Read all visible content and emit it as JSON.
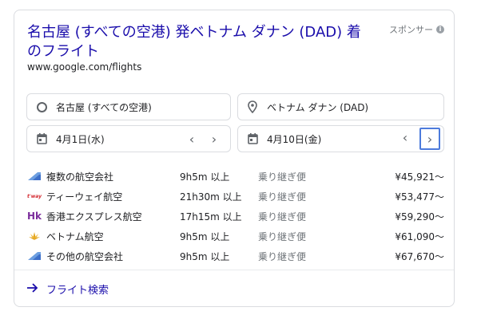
{
  "ad": {
    "title": "名古屋 (すべての空港) 発ベトナム ダナン (DAD) 着のフライト",
    "sponsor_label": "スポンサー",
    "url": "www.google.com/flights"
  },
  "search": {
    "origin": "名古屋 (すべての空港)",
    "destination": "ベトナム ダナン (DAD)",
    "depart_date": "4月1日(水)",
    "return_date": "4月10日(金)"
  },
  "results": [
    {
      "airline": "複数の航空会社",
      "logo": "multi-airline-logo",
      "duration": "9h5m 以上",
      "stops": "乗り継ぎ便",
      "price": "¥45,921〜"
    },
    {
      "airline": "ティーウェイ航空",
      "logo": "tway-logo",
      "duration": "21h30m 以上",
      "stops": "乗り継ぎ便",
      "price": "¥53,477〜"
    },
    {
      "airline": "香港エクスプレス航空",
      "logo": "hk-express-logo",
      "duration": "17h15m 以上",
      "stops": "乗り継ぎ便",
      "price": "¥59,290〜"
    },
    {
      "airline": "ベトナム航空",
      "logo": "vietnam-airlines-logo",
      "duration": "9h5m 以上",
      "stops": "乗り継ぎ便",
      "price": "¥61,090〜"
    },
    {
      "airline": "その他の航空会社",
      "logo": "other-airlines-logo",
      "duration": "9h5m 以上",
      "stops": "乗り継ぎ便",
      "price": "¥67,670〜"
    }
  ],
  "footer": {
    "search_label": "フライト検索"
  },
  "colors": {
    "link": "#1a0dab",
    "focus": "#4d7bdc"
  }
}
